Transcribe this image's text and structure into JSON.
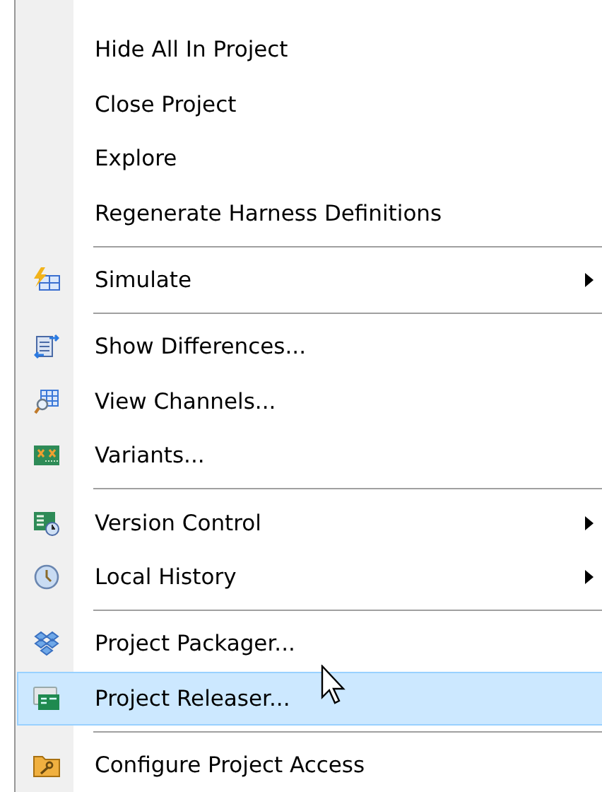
{
  "menu": {
    "groups": [
      [
        {
          "label": "Hide All In Project",
          "selected": false
        },
        {
          "label": "Close Project",
          "selected": false
        },
        {
          "label": "Explore",
          "selected": false
        },
        {
          "label": "Regenerate Harness Definitions",
          "selected": false
        }
      ],
      [
        {
          "label": "Simulate",
          "submenu": true,
          "selected": false
        }
      ],
      [
        {
          "label": "Show Differences...",
          "selected": false
        },
        {
          "label": "View Channels...",
          "selected": false
        },
        {
          "label": "Variants...",
          "selected": false
        }
      ],
      [
        {
          "label": "Version Control",
          "submenu": true,
          "selected": false
        },
        {
          "label": "Local History",
          "submenu": true,
          "selected": false
        }
      ],
      [
        {
          "label": "Project Packager...",
          "selected": false
        },
        {
          "label": "Project Releaser...",
          "selected": true
        }
      ],
      [
        {
          "label": "Configure Project Access",
          "selected": false
        }
      ]
    ]
  }
}
